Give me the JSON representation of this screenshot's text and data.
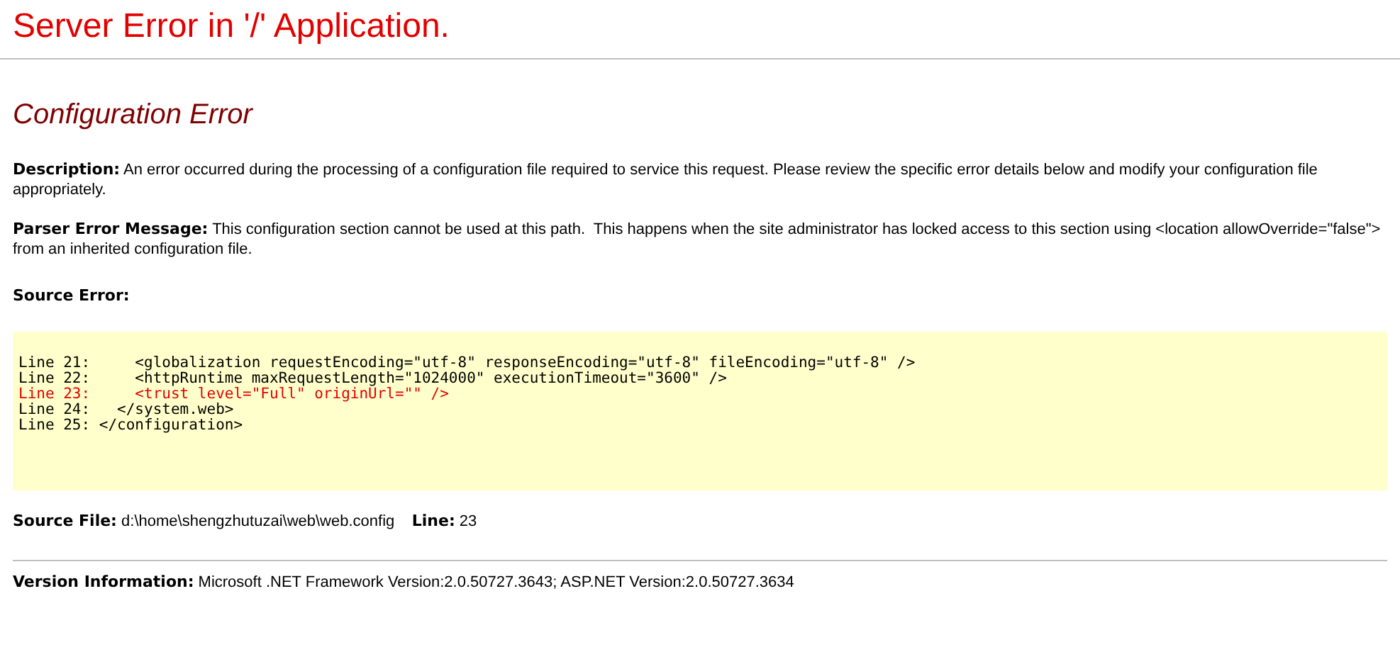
{
  "title": "Server Error in '/' Application.",
  "error_title": "Configuration Error",
  "description": "**Description:** An error occurred during the processing of a configuration file required to service this request. Please review the specific error details below and modify your configuration file appropriately.",
  "parser_message": "**Parser Error Message:** This configuration section cannot be used at this path.  This happens when the site administrator has locked access to this section using <location allowOverride=\"false\"> from an inherited configuration file.",
  "source_error_label": "Source Error:",
  "code_lines": [
    {
      "text": "Line 21:     <globalization requestEncoding=\"utf-8\" responseEncoding=\"utf-8\" fileEncoding=\"utf-8\" />",
      "highlighted": false
    },
    {
      "text": "Line 22:     <httpRuntime maxRequestLength=\"1024000\" executionTimeout=\"3600\" />",
      "highlighted": false
    },
    {
      "text": "Line 23:     <trust level=\"Full\" originUrl=\"\" />",
      "highlighted": true
    },
    {
      "text": "Line 24:   </system.web>",
      "highlighted": false
    },
    {
      "text": "Line 25: </configuration>",
      "highlighted": false
    }
  ],
  "source_file": "**Source File:** d:\\home\\shengzhutuzai\\web\\web.config    **Line:** 23",
  "version_info": "**Version Information:** Microsoft .NET Framework Version:2.0.50727.3643; ASP.NET Version:2.0.50727.3634"
}
